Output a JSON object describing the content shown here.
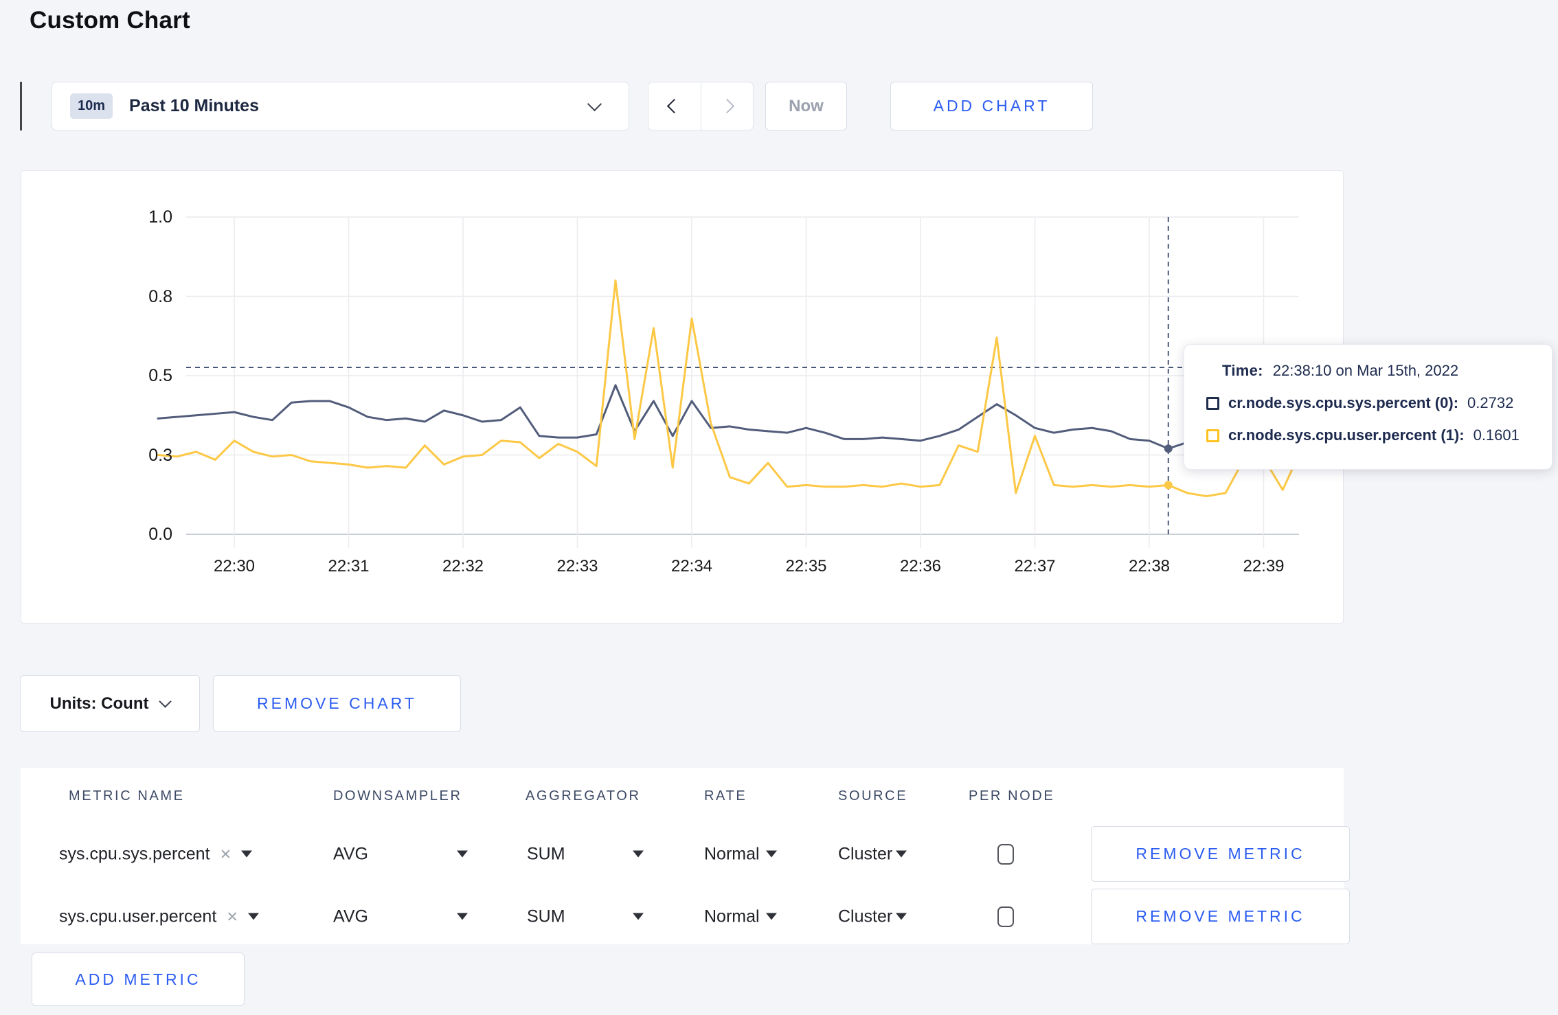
{
  "page": {
    "title": "Custom Chart"
  },
  "toolbar": {
    "time_range_badge": "10m",
    "time_range_label": "Past 10 Minutes",
    "now_label": "Now",
    "add_chart_label": "ADD CHART"
  },
  "icons": {
    "x_char": "×",
    "time_selector": "chevron-down-icon",
    "prev": "chevron-left-icon",
    "next": "chevron-right-icon",
    "units": "chevron-down-icon",
    "dropdown": "caret-down-icon"
  },
  "chart_data": {
    "type": "line",
    "ylim": [
      0,
      1
    ],
    "grid": true,
    "y_ticks": [
      {
        "label": "1.0",
        "value": 1.0
      },
      {
        "label": "0.8",
        "value": 0.75
      },
      {
        "label": "0.5",
        "value": 0.5
      },
      {
        "label": "0.3",
        "value": 0.25
      },
      {
        "label": "0.0",
        "value": 0.0
      }
    ],
    "x_ticks": [
      "22:30",
      "22:31",
      "22:32",
      "22:33",
      "22:34",
      "22:35",
      "22:36",
      "22:37",
      "22:38",
      "22:39"
    ],
    "start_time": "22:29:20",
    "interval_seconds": 10,
    "series": [
      {
        "name": "cr.node.sys.cpu.sys.percent",
        "color": "#525d7b",
        "values": [
          0.365,
          0.37,
          0.375,
          0.38,
          0.385,
          0.37,
          0.36,
          0.415,
          0.42,
          0.42,
          0.4,
          0.37,
          0.36,
          0.365,
          0.355,
          0.39,
          0.375,
          0.355,
          0.36,
          0.4,
          0.31,
          0.305,
          0.305,
          0.315,
          0.47,
          0.325,
          0.42,
          0.31,
          0.42,
          0.335,
          0.34,
          0.33,
          0.325,
          0.32,
          0.335,
          0.32,
          0.3,
          0.3,
          0.305,
          0.3,
          0.295,
          0.31,
          0.33,
          0.37,
          0.41,
          0.375,
          0.335,
          0.32,
          0.33,
          0.335,
          0.325,
          0.3,
          0.295,
          0.27,
          0.29,
          0.3,
          0.295,
          0.3,
          0.31,
          0.3,
          0.305
        ]
      },
      {
        "name": "cr.node.sys.cpu.user.percent",
        "color": "#fcc846",
        "values": [
          0.25,
          0.245,
          0.26,
          0.235,
          0.295,
          0.26,
          0.245,
          0.25,
          0.23,
          0.225,
          0.22,
          0.21,
          0.215,
          0.21,
          0.28,
          0.22,
          0.245,
          0.25,
          0.295,
          0.29,
          0.24,
          0.285,
          0.26,
          0.215,
          0.8,
          0.3,
          0.65,
          0.21,
          0.68,
          0.35,
          0.18,
          0.16,
          0.225,
          0.15,
          0.155,
          0.15,
          0.15,
          0.155,
          0.15,
          0.16,
          0.15,
          0.155,
          0.28,
          0.26,
          0.62,
          0.13,
          0.31,
          0.155,
          0.15,
          0.155,
          0.15,
          0.155,
          0.15,
          0.155,
          0.13,
          0.12,
          0.13,
          0.24,
          0.24,
          0.14,
          0.27
        ]
      }
    ],
    "crosshair": {
      "index": 53,
      "time": "22:38:10",
      "h_value": 0.526
    }
  },
  "tooltip": {
    "time_label": "Time:",
    "time_value": "22:38:10 on Mar 15th, 2022",
    "rows": [
      {
        "name": "cr.node.sys.cpu.sys.percent (0):",
        "value": "0.2732",
        "color": "#1f2d4d"
      },
      {
        "name": "cr.node.sys.cpu.user.percent (1):",
        "value": "0.1601",
        "color": "#fcc220"
      }
    ]
  },
  "chart_controls": {
    "units_label": "Units: Count",
    "remove_chart_label": "REMOVE CHART"
  },
  "metrics_table": {
    "columns": [
      "METRIC NAME",
      "DOWNSAMPLER",
      "AGGREGATOR",
      "RATE",
      "SOURCE",
      "PER NODE"
    ],
    "rows": [
      {
        "metric_name": "sys.cpu.sys.percent",
        "downsampler": "AVG",
        "aggregator": "SUM",
        "rate": "Normal",
        "source": "Cluster",
        "per_node_checked": false,
        "remove_label": "REMOVE METRIC"
      },
      {
        "metric_name": "sys.cpu.user.percent",
        "downsampler": "AVG",
        "aggregator": "SUM",
        "rate": "Normal",
        "source": "Cluster",
        "per_node_checked": false,
        "remove_label": "REMOVE METRIC"
      }
    ],
    "add_metric_label": "ADD METRIC"
  }
}
